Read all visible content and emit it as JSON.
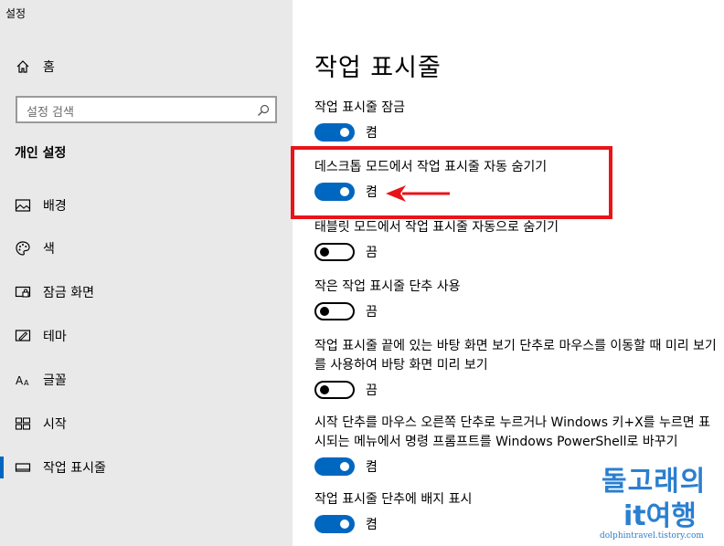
{
  "app": {
    "title": "설정"
  },
  "sidebar": {
    "home_label": "홈",
    "search_placeholder": "설정 검색",
    "section_title": "개인 설정",
    "items": [
      {
        "label": "배경",
        "icon": "image-icon"
      },
      {
        "label": "색",
        "icon": "palette-icon"
      },
      {
        "label": "잠금 화면",
        "icon": "lock-screen-icon"
      },
      {
        "label": "테마",
        "icon": "theme-icon"
      },
      {
        "label": "글꼴",
        "icon": "font-icon"
      },
      {
        "label": "시작",
        "icon": "start-icon"
      },
      {
        "label": "작업 표시줄",
        "icon": "taskbar-icon",
        "active": true
      }
    ]
  },
  "main": {
    "title": "작업 표시줄",
    "settings": [
      {
        "label": "작업 표시줄 잠금",
        "state": "켬",
        "on": true
      },
      {
        "label": "데스크톱 모드에서 작업 표시줄 자동 숨기기",
        "state": "켬",
        "on": true
      },
      {
        "label": "태블릿 모드에서 작업 표시줄 자동으로 숨기기",
        "state": "끔",
        "on": false
      },
      {
        "label": "작은 작업 표시줄 단추 사용",
        "state": "끔",
        "on": false
      },
      {
        "label": "작업 표시줄 끝에 있는 바탕 화면 보기 단추로 마우스를 이동할 때 미리 보기를 사용하여 바탕 화면 미리 보기",
        "state": "끔",
        "on": false
      },
      {
        "label": "시작 단추를 마우스 오른쪽 단추로 누르거나 Windows 키+X를 누르면 표시되는 메뉴에서 명령 프롬프트를 Windows PowerShell로 바꾸기",
        "state": "켬",
        "on": true
      },
      {
        "label": "작업 표시줄 단추에 배지 표시",
        "state": "켬",
        "on": true
      }
    ]
  },
  "watermark": {
    "line1": "돌고래의",
    "line2": "it여행",
    "url": "dolphintravel.tistory.com"
  },
  "colors": {
    "accent": "#0067c0",
    "highlight": "#e8141a",
    "sidebar_bg": "#e9e9e9"
  }
}
